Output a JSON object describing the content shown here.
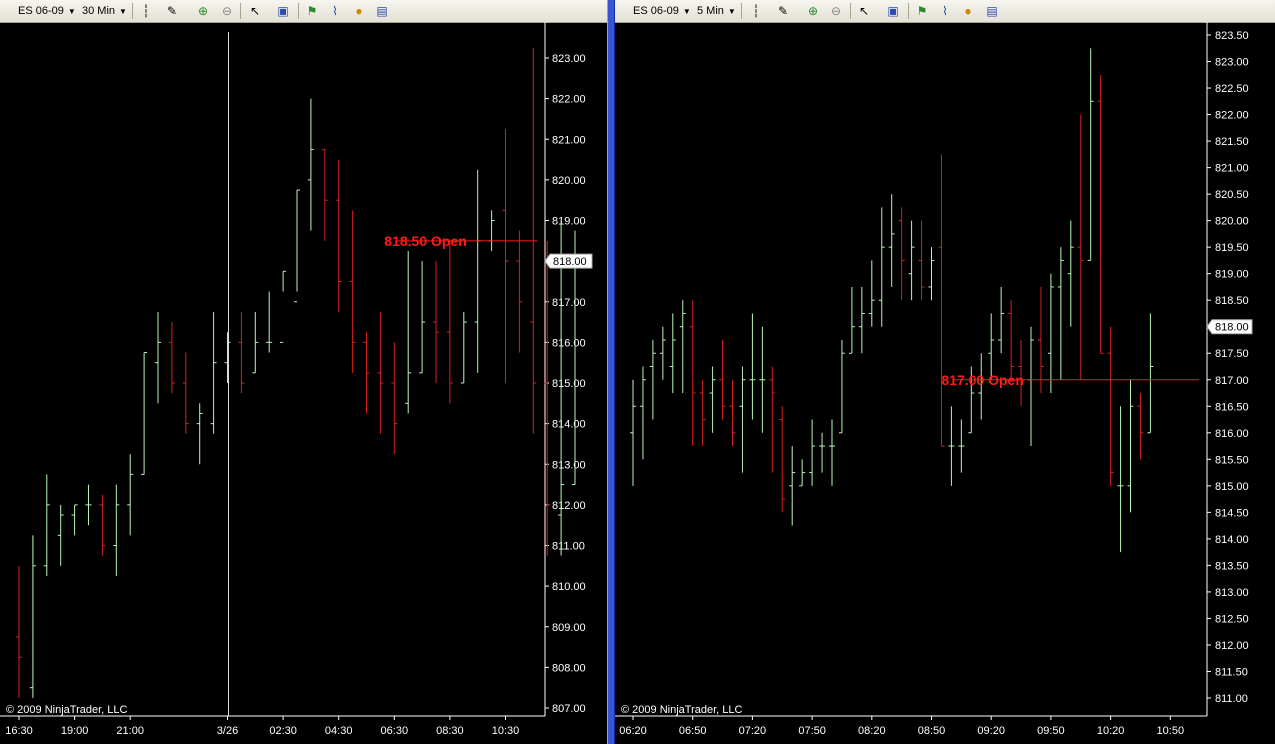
{
  "watermark": "© 2009 NinjaTrader, LLC",
  "colors": {
    "up": "#b9f5b9",
    "down": "#d42020",
    "open_line": "#ff1a1a",
    "background": "#000000",
    "axis_text": "#ffffff"
  },
  "panels": [
    {
      "toolbar": {
        "instrument": "ES 06-09",
        "interval": "30 Min"
      },
      "icons": [
        "bar-type-icon",
        "drawing-pencil-icon",
        "zoom-in-icon",
        "zoom-out-icon",
        "pointer-icon",
        "properties-icon",
        "strategy-icon",
        "chart-indicator-icon",
        "coin-icon",
        "data-box-icon"
      ]
    },
    {
      "toolbar": {
        "instrument": "ES 06-09",
        "interval": "5 Min"
      },
      "icons": [
        "bar-type-icon",
        "drawing-pencil-icon",
        "zoom-in-icon",
        "zoom-out-icon",
        "pointer-icon",
        "properties-icon",
        "strategy-icon",
        "chart-indicator-icon",
        "coin-icon",
        "data-box-icon"
      ]
    }
  ],
  "chart_data": [
    {
      "type": "ohlc",
      "ylim": [
        806.75,
        823.75
      ],
      "y_ticks": [
        "807.00",
        "808.00",
        "809.00",
        "810.00",
        "811.00",
        "812.00",
        "813.00",
        "814.00",
        "815.00",
        "816.00",
        "817.00",
        "818.00",
        "819.00",
        "820.00",
        "821.00",
        "822.00",
        "823.00"
      ],
      "x_ticks": [
        {
          "label": "16:30",
          "bar": 0
        },
        {
          "label": "19:00",
          "bar": 4
        },
        {
          "label": "21:00",
          "bar": 8
        },
        {
          "label": "3/26",
          "bar": 15
        },
        {
          "label": "02:30",
          "bar": 19
        },
        {
          "label": "04:30",
          "bar": 23
        },
        {
          "label": "06:30",
          "bar": 27
        },
        {
          "label": "08:30",
          "bar": 31
        },
        {
          "label": "10:30",
          "bar": 35
        }
      ],
      "session_break_bar": 15,
      "current_price": "818.00",
      "annotation": {
        "label": "818.50 Open",
        "value": 818.5,
        "from_bar": 27,
        "to_bar": 37
      },
      "bars": [
        {
          "o": 808.75,
          "h": 810.5,
          "l": 807.25,
          "c": 808.25
        },
        {
          "o": 807.5,
          "h": 811.25,
          "l": 807.25,
          "c": 810.5
        },
        {
          "o": 810.5,
          "h": 812.75,
          "l": 810.25,
          "c": 812.0
        },
        {
          "o": 811.25,
          "h": 812.0,
          "l": 810.5,
          "c": 811.75
        },
        {
          "o": 811.75,
          "h": 812.0,
          "l": 811.25,
          "c": 812.0
        },
        {
          "o": 812.0,
          "h": 812.5,
          "l": 811.5,
          "c": 812.0
        },
        {
          "o": 812.0,
          "h": 812.25,
          "l": 810.75,
          "c": 811.0
        },
        {
          "o": 811.0,
          "h": 812.5,
          "l": 810.25,
          "c": 812.0
        },
        {
          "o": 812.0,
          "h": 813.25,
          "l": 811.25,
          "c": 812.75
        },
        {
          "o": 812.75,
          "h": 815.75,
          "l": 812.75,
          "c": 815.75
        },
        {
          "o": 815.5,
          "h": 816.75,
          "l": 814.5,
          "c": 816.0
        },
        {
          "o": 816.0,
          "h": 816.5,
          "l": 814.75,
          "c": 815.0
        },
        {
          "o": 815.0,
          "h": 815.75,
          "l": 813.75,
          "c": 814.0
        },
        {
          "o": 814.0,
          "h": 814.5,
          "l": 813.0,
          "c": 814.25
        },
        {
          "o": 814.0,
          "h": 816.75,
          "l": 813.75,
          "c": 815.5
        },
        {
          "o": 815.5,
          "h": 816.25,
          "l": 815.0,
          "c": 816.0
        },
        {
          "o": 816.0,
          "h": 816.75,
          "l": 814.75,
          "c": 815.0
        },
        {
          "o": 815.25,
          "h": 816.75,
          "l": 815.25,
          "c": 816.0
        },
        {
          "o": 816.0,
          "h": 817.25,
          "l": 815.75,
          "c": 816.0
        },
        {
          "o": 816.0,
          "h": 817.75,
          "l": 817.25,
          "c": 817.75
        },
        {
          "o": 817.0,
          "h": 819.75,
          "l": 817.25,
          "c": 819.75
        },
        {
          "o": 820.0,
          "h": 822.0,
          "l": 818.75,
          "c": 820.75
        },
        {
          "o": 820.75,
          "h": 820.75,
          "l": 818.5,
          "c": 819.5
        },
        {
          "o": 819.5,
          "h": 820.5,
          "l": 816.75,
          "c": 817.5
        },
        {
          "o": 817.5,
          "h": 819.25,
          "l": 815.25,
          "c": 816.0
        },
        {
          "o": 816.0,
          "h": 816.25,
          "l": 814.25,
          "c": 815.25
        },
        {
          "o": 815.25,
          "h": 816.75,
          "l": 813.75,
          "c": 815.0
        },
        {
          "o": 815.0,
          "h": 816.0,
          "l": 813.25,
          "c": 814.0
        },
        {
          "o": 814.5,
          "h": 818.25,
          "l": 814.25,
          "c": 815.25
        },
        {
          "o": 815.25,
          "h": 818.0,
          "l": 815.25,
          "c": 816.5
        },
        {
          "o": 816.5,
          "h": 818.0,
          "l": 815.0,
          "c": 816.25
        },
        {
          "o": 816.25,
          "h": 818.5,
          "l": 814.5,
          "c": 815.0
        },
        {
          "o": 815.0,
          "h": 816.75,
          "l": 815.0,
          "c": 816.5
        },
        {
          "o": 816.5,
          "h": 820.25,
          "l": 815.25,
          "c": 818.5
        },
        {
          "o": 818.5,
          "h": 819.25,
          "l": 818.25,
          "c": 819.0
        },
        {
          "o": 819.25,
          "h": 821.25,
          "l": 815.0,
          "c": 818.0
        },
        {
          "o": 818.0,
          "h": 818.75,
          "l": 815.75,
          "c": 817.0
        },
        {
          "o": 816.5,
          "h": 823.25,
          "l": 813.75,
          "c": 815.0
        },
        {
          "o": 815.0,
          "h": 818.5,
          "l": 810.75,
          "c": 812.0
        },
        {
          "o": 811.75,
          "h": 819.0,
          "l": 810.75,
          "c": 812.5
        },
        {
          "o": 812.5,
          "h": 818.75,
          "l": 812.5,
          "c": 818.0
        }
      ]
    },
    {
      "type": "ohlc",
      "ylim": [
        810.75,
        823.6
      ],
      "y_ticks": [
        "811.00",
        "811.50",
        "812.00",
        "812.50",
        "813.00",
        "813.50",
        "814.00",
        "814.50",
        "815.00",
        "815.50",
        "816.00",
        "816.50",
        "817.00",
        "817.50",
        "818.00",
        "818.50",
        "819.00",
        "819.50",
        "820.00",
        "820.50",
        "821.00",
        "821.50",
        "822.00",
        "822.50",
        "823.00",
        "823.50"
      ],
      "x_ticks": [
        {
          "label": "06:20",
          "bar": 0
        },
        {
          "label": "06:50",
          "bar": 6
        },
        {
          "label": "07:20",
          "bar": 12
        },
        {
          "label": "07:50",
          "bar": 18
        },
        {
          "label": "08:20",
          "bar": 24
        },
        {
          "label": "08:50",
          "bar": 30
        },
        {
          "label": "09:20",
          "bar": 36
        },
        {
          "label": "09:50",
          "bar": 42
        },
        {
          "label": "10:20",
          "bar": 48
        },
        {
          "label": "10:50",
          "bar": 54
        }
      ],
      "current_price": "818.00",
      "annotation": {
        "label": "817.00 Open",
        "value": 817.0,
        "from_bar": 32,
        "to_bar": 58
      },
      "bars": [
        {
          "o": 816.0,
          "h": 817.0,
          "l": 815.0,
          "c": 816.5
        },
        {
          "o": 816.5,
          "h": 817.25,
          "l": 815.5,
          "c": 817.0
        },
        {
          "o": 817.25,
          "h": 817.75,
          "l": 816.25,
          "c": 817.5
        },
        {
          "o": 817.5,
          "h": 818.0,
          "l": 817.0,
          "c": 817.75
        },
        {
          "o": 817.25,
          "h": 818.25,
          "l": 816.75,
          "c": 817.75
        },
        {
          "o": 818.0,
          "h": 818.5,
          "l": 816.75,
          "c": 818.25
        },
        {
          "o": 818.0,
          "h": 818.5,
          "l": 815.75,
          "c": 816.75
        },
        {
          "o": 816.75,
          "h": 817.0,
          "l": 815.75,
          "c": 816.25
        },
        {
          "o": 816.75,
          "h": 817.25,
          "l": 816.0,
          "c": 817.0
        },
        {
          "o": 817.0,
          "h": 817.75,
          "l": 816.25,
          "c": 816.5
        },
        {
          "o": 816.5,
          "h": 817.0,
          "l": 815.75,
          "c": 816.0
        },
        {
          "o": 816.5,
          "h": 817.25,
          "l": 815.25,
          "c": 817.0
        },
        {
          "o": 817.0,
          "h": 818.25,
          "l": 816.25,
          "c": 817.0
        },
        {
          "o": 817.0,
          "h": 818.0,
          "l": 816.0,
          "c": 817.0
        },
        {
          "o": 817.0,
          "h": 817.25,
          "l": 815.25,
          "c": 816.75
        },
        {
          "o": 816.25,
          "h": 816.5,
          "l": 814.5,
          "c": 814.75
        },
        {
          "o": 815.0,
          "h": 815.75,
          "l": 814.25,
          "c": 815.25
        },
        {
          "o": 815.0,
          "h": 815.5,
          "l": 815.0,
          "c": 815.25
        },
        {
          "o": 815.25,
          "h": 816.25,
          "l": 815.0,
          "c": 815.75
        },
        {
          "o": 815.75,
          "h": 816.0,
          "l": 815.25,
          "c": 815.75
        },
        {
          "o": 815.75,
          "h": 816.25,
          "l": 815.0,
          "c": 815.75
        },
        {
          "o": 816.0,
          "h": 817.75,
          "l": 816.0,
          "c": 817.5
        },
        {
          "o": 817.5,
          "h": 818.75,
          "l": 817.5,
          "c": 818.0
        },
        {
          "o": 818.0,
          "h": 818.75,
          "l": 817.5,
          "c": 818.25
        },
        {
          "o": 818.25,
          "h": 819.25,
          "l": 818.0,
          "c": 818.5
        },
        {
          "o": 818.5,
          "h": 820.25,
          "l": 818.0,
          "c": 819.5
        },
        {
          "o": 819.5,
          "h": 820.5,
          "l": 818.75,
          "c": 819.75
        },
        {
          "o": 820.0,
          "h": 820.25,
          "l": 818.5,
          "c": 819.25
        },
        {
          "o": 819.0,
          "h": 820.0,
          "l": 818.5,
          "c": 819.5
        },
        {
          "o": 819.25,
          "h": 820.0,
          "l": 818.5,
          "c": 818.75
        },
        {
          "o": 818.75,
          "h": 819.5,
          "l": 818.5,
          "c": 819.25
        },
        {
          "o": 819.5,
          "h": 821.25,
          "l": 815.75,
          "c": 815.75
        },
        {
          "o": 815.75,
          "h": 816.5,
          "l": 815.0,
          "c": 815.75
        },
        {
          "o": 815.75,
          "h": 816.25,
          "l": 815.25,
          "c": 815.75
        },
        {
          "o": 816.0,
          "h": 817.25,
          "l": 816.0,
          "c": 816.75
        },
        {
          "o": 816.75,
          "h": 817.5,
          "l": 816.25,
          "c": 817.0
        },
        {
          "o": 817.5,
          "h": 818.25,
          "l": 817.0,
          "c": 817.75
        },
        {
          "o": 817.75,
          "h": 818.75,
          "l": 817.5,
          "c": 818.25
        },
        {
          "o": 818.25,
          "h": 818.5,
          "l": 817.0,
          "c": 817.25
        },
        {
          "o": 817.25,
          "h": 817.75,
          "l": 816.5,
          "c": 817.0
        },
        {
          "o": 817.0,
          "h": 818.0,
          "l": 815.75,
          "c": 817.75
        },
        {
          "o": 817.75,
          "h": 818.75,
          "l": 816.75,
          "c": 817.25
        },
        {
          "o": 817.5,
          "h": 819.0,
          "l": 816.75,
          "c": 818.75
        },
        {
          "o": 818.75,
          "h": 819.5,
          "l": 817.0,
          "c": 819.25
        },
        {
          "o": 819.0,
          "h": 820.0,
          "l": 818.0,
          "c": 819.5
        },
        {
          "o": 819.5,
          "h": 822.0,
          "l": 817.0,
          "c": 819.25
        },
        {
          "o": 819.25,
          "h": 823.25,
          "l": 819.25,
          "c": 822.25
        },
        {
          "o": 822.25,
          "h": 822.75,
          "l": 817.5,
          "c": 817.5
        },
        {
          "o": 817.5,
          "h": 818.0,
          "l": 815.0,
          "c": 815.25
        },
        {
          "o": 815.0,
          "h": 816.5,
          "l": 813.75,
          "c": 815.0
        },
        {
          "o": 815.0,
          "h": 817.0,
          "l": 814.5,
          "c": 816.5
        },
        {
          "o": 816.5,
          "h": 816.75,
          "l": 815.5,
          "c": 816.0
        },
        {
          "o": 816.0,
          "h": 818.25,
          "l": 816.0,
          "c": 817.25
        }
      ]
    }
  ]
}
